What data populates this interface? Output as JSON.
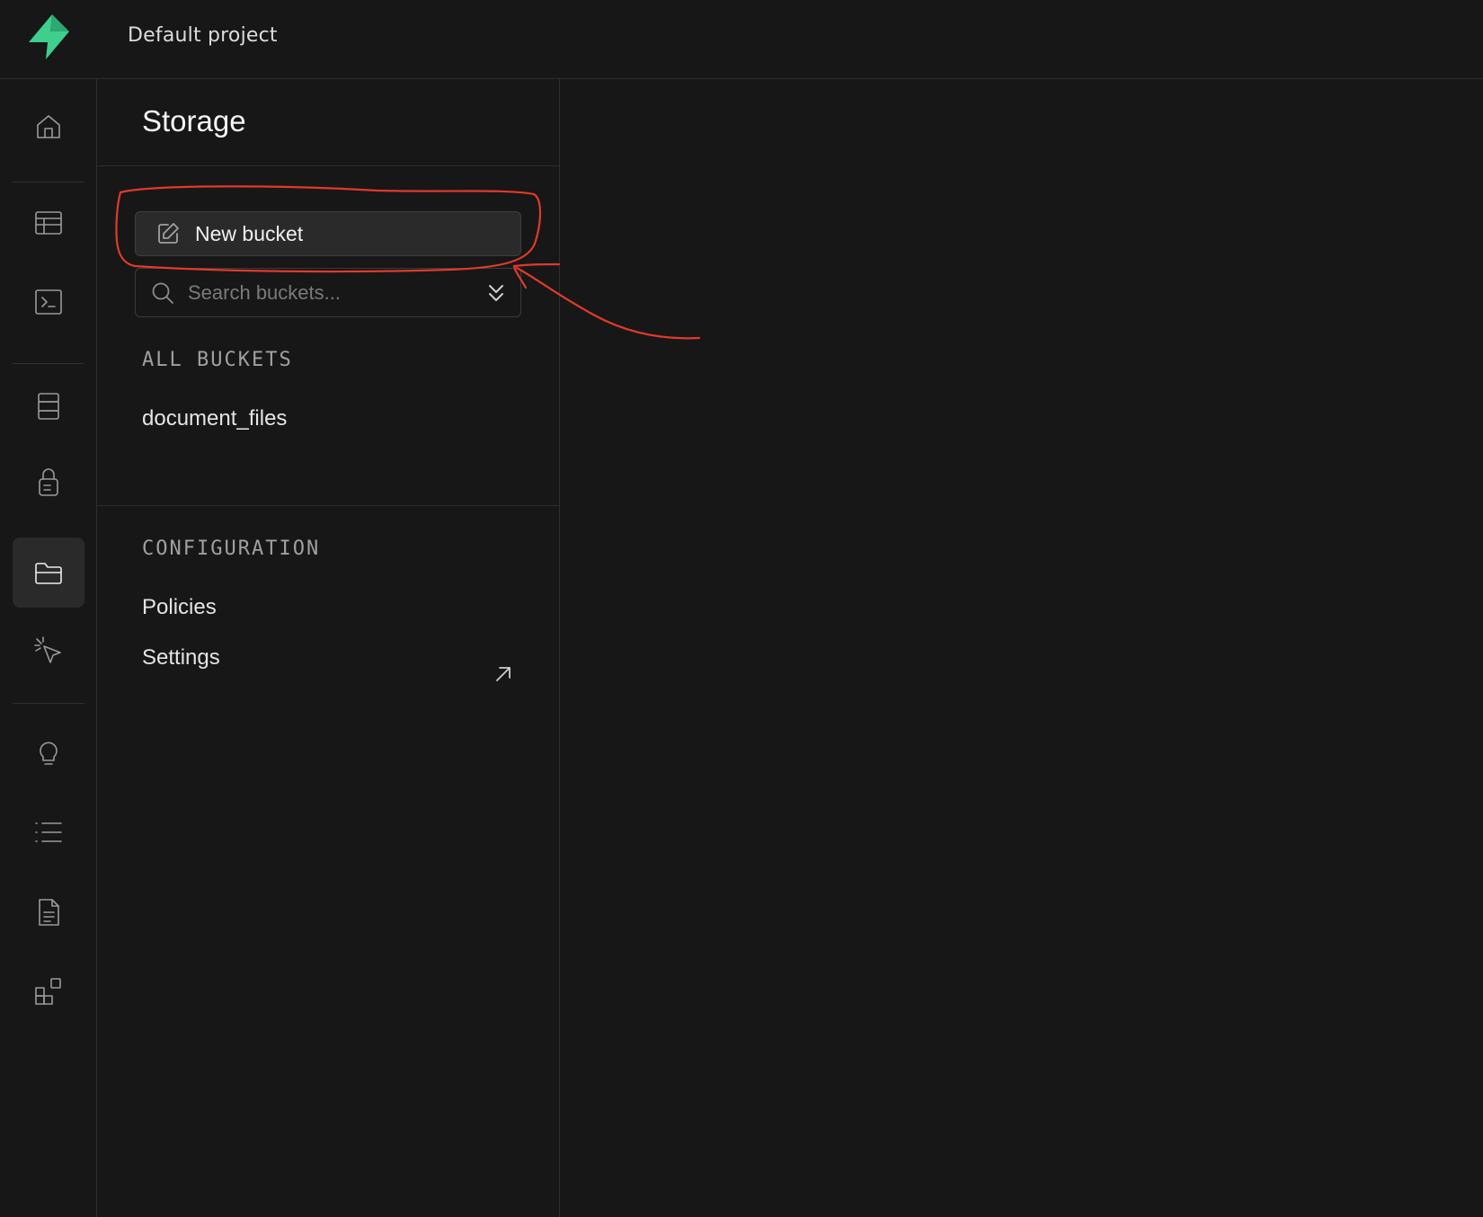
{
  "header": {
    "project_name": "Default project",
    "logo_icon": "supabase-bolt-logo",
    "logo_color": "#3ecf8e"
  },
  "rail": {
    "items": [
      {
        "icon": "home-icon",
        "active": false
      },
      {
        "icon": "table-editor-icon",
        "active": false
      },
      {
        "icon": "sql-editor-icon",
        "active": false
      },
      {
        "icon": "database-icon",
        "active": false
      },
      {
        "icon": "authentication-icon",
        "active": false
      },
      {
        "icon": "storage-icon",
        "active": true
      },
      {
        "icon": "realtime-icon",
        "active": false
      },
      {
        "icon": "advisors-icon",
        "active": false
      },
      {
        "icon": "logs-icon",
        "active": false
      },
      {
        "icon": "api-docs-icon",
        "active": false
      },
      {
        "icon": "integrations-icon",
        "active": false
      }
    ]
  },
  "panel": {
    "title": "Storage",
    "new_bucket_label": "New bucket",
    "search": {
      "placeholder": "Search buckets...",
      "value": ""
    },
    "buckets_heading": "ALL BUCKETS",
    "buckets": [
      "document_files"
    ],
    "config_heading": "CONFIGURATION",
    "config_links": [
      {
        "label": "Policies",
        "external": false
      },
      {
        "label": "Settings",
        "external": true
      }
    ]
  },
  "annotation_color": "#e03a2b"
}
